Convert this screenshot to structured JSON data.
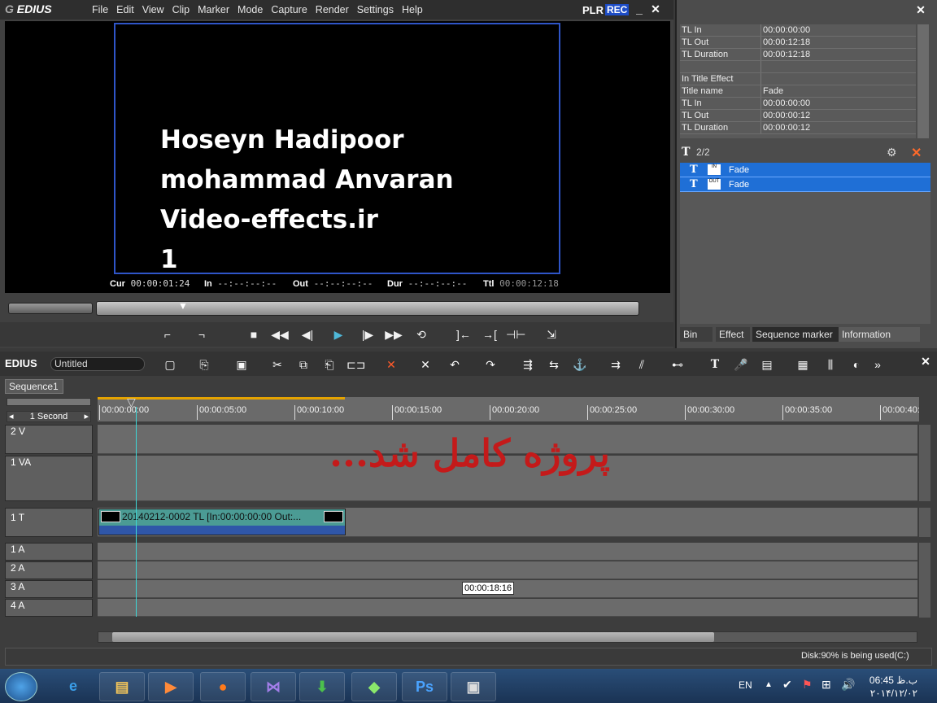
{
  "player": {
    "logo": "EDIUS",
    "menu": [
      "File",
      "Edit",
      "View",
      "Clip",
      "Marker",
      "Mode",
      "Capture",
      "Render",
      "Settings",
      "Help"
    ],
    "mode_plr": "PLR",
    "mode_rec": "REC",
    "title_lines": [
      "Hoseyn Hadipoor",
      "mohammad Anvaran",
      "Video-effects.ir",
      "1"
    ],
    "timecodes": {
      "cur_label": "Cur",
      "cur": "00:00:01:24",
      "in_label": "In",
      "in": "--:--:--:--",
      "out_label": "Out",
      "out": "--:--:--:--",
      "dur_label": "Dur",
      "dur": "--:--:--:--",
      "ttl_label": "Ttl",
      "ttl": "00:00:12:18"
    }
  },
  "info": {
    "rows": [
      [
        "TL In",
        "00:00:00:00"
      ],
      [
        "TL Out",
        "00:00:12:18"
      ],
      [
        "TL Duration",
        "00:00:12:18"
      ],
      [
        "",
        ""
      ],
      [
        "In Title Effect",
        ""
      ],
      [
        "Title name",
        "Fade"
      ],
      [
        "TL In",
        "00:00:00:00"
      ],
      [
        "TL Out",
        "00:00:00:12"
      ],
      [
        "TL Duration",
        "00:00:00:12"
      ]
    ],
    "counter": "2/2",
    "effects": [
      {
        "badge": "IN",
        "name": "Fade"
      },
      {
        "badge": "OUT",
        "name": "Fade"
      }
    ],
    "tabs": [
      "Bin",
      "Effect",
      "Sequence marker",
      "Information"
    ]
  },
  "timeline": {
    "logo": "EDIUS",
    "project_name": "Untitled",
    "sequence_tab": "Sequence1",
    "scale": "1 Second",
    "ruler": [
      "00:00:00:00",
      "00:00:05:00",
      "00:00:10:00",
      "00:00:15:00",
      "00:00:20:00",
      "00:00:25:00",
      "00:00:30:00",
      "00:00:35:00",
      "00:00:40:"
    ],
    "tracks": [
      "2 V",
      "1 VA",
      "1 T",
      "1 A",
      "2 A",
      "3 A",
      "4 A"
    ],
    "clip_label": "20140212-0002  TL [In:00:00:00:00 Out:...",
    "overlay_text": "پروژه کامل شد...",
    "tooltip": "00:00:18:16",
    "status": "Disk:90% is being used(C:)"
  },
  "taskbar": {
    "lang": "EN",
    "time": "06:45 ب.ظ",
    "date": "۲۰۱۴/۱۲/۰۲"
  }
}
